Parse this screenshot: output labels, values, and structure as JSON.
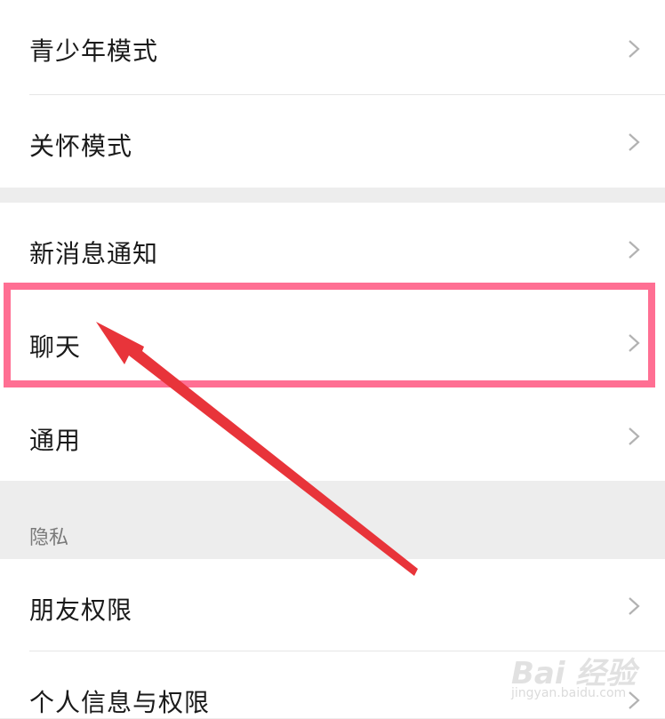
{
  "settings": {
    "group1": [
      {
        "label": "青少年模式"
      },
      {
        "label": "关怀模式"
      }
    ],
    "group2": [
      {
        "label": "新消息通知"
      },
      {
        "label": "聊天"
      },
      {
        "label": "通用"
      }
    ],
    "privacy": {
      "title": "隐私",
      "items": [
        {
          "label": "朋友权限"
        },
        {
          "label": "个人信息与权限"
        }
      ]
    }
  },
  "annotation": {
    "highlight_color": "#ff6f93",
    "arrow_color": "#e8343a",
    "highlighted_item": "聊天"
  },
  "watermark": {
    "brand": "Bai 经验",
    "url": "jingyan.baidu.com"
  },
  "icons": {
    "chevron": "chevron-right-icon"
  },
  "colors": {
    "background": "#ededed",
    "row": "#ffffff",
    "text": "#1a1a1a",
    "section_title": "#7a7a7a"
  }
}
